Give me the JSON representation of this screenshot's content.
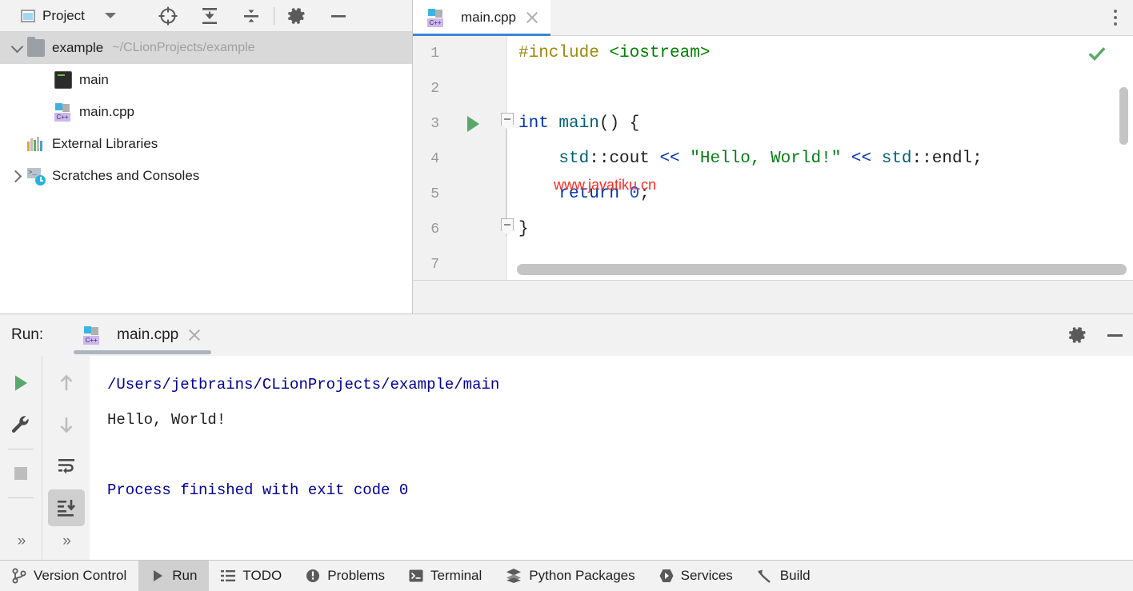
{
  "project_panel": {
    "title": "Project",
    "icons": [
      "project-window-icon",
      "chevron-down-icon",
      "locate-icon",
      "expand-all-icon",
      "collapse-all-icon",
      "gear-icon",
      "minimize-icon"
    ],
    "tree": [
      {
        "label": "example",
        "path": "~/CLionProjects/example",
        "icon": "folder-icon",
        "twisty": "down",
        "selected": true,
        "depth": 0
      },
      {
        "label": "main",
        "path": "",
        "icon": "binary-icon",
        "twisty": "none",
        "selected": false,
        "depth": 1
      },
      {
        "label": "main.cpp",
        "path": "",
        "icon": "cpp-file-icon",
        "twisty": "none",
        "selected": false,
        "depth": 1
      },
      {
        "label": "External Libraries",
        "path": "",
        "icon": "libraries-icon",
        "twisty": "none",
        "selected": false,
        "depth": 0
      },
      {
        "label": "Scratches and Consoles",
        "path": "",
        "icon": "scratches-icon",
        "twisty": "right",
        "selected": false,
        "depth": 0
      }
    ]
  },
  "editor": {
    "tab": {
      "label": "main.cpp",
      "icon": "cpp-file-icon",
      "close": "close-icon",
      "active": true
    },
    "kebab": "more-options-icon",
    "inspection_status": "ok-check-icon",
    "watermark": "www.javatiku.cn",
    "gutter_numbers": [
      "1",
      "2",
      "3",
      "4",
      "5",
      "6",
      "7"
    ],
    "run_gutter_line": 3,
    "fold_lines": [
      3,
      6
    ],
    "lines": [
      {
        "n": 1,
        "tokens": [
          {
            "t": "#include ",
            "c": "tk-pre"
          },
          {
            "t": "<iostream>",
            "c": "tk-inc"
          }
        ]
      },
      {
        "n": 2,
        "tokens": []
      },
      {
        "n": 3,
        "tokens": [
          {
            "t": "int ",
            "c": "tk-kw"
          },
          {
            "t": "main",
            "c": "tk-fn"
          },
          {
            "t": "() {",
            "c": "tk-pl"
          }
        ]
      },
      {
        "n": 4,
        "tokens": [
          {
            "t": "    ",
            "c": "tk-pl"
          },
          {
            "t": "std",
            "c": "tk-ns"
          },
          {
            "t": "::",
            "c": "tk-pl"
          },
          {
            "t": "cout ",
            "c": "tk-pl"
          },
          {
            "t": "<< ",
            "c": "tk-op"
          },
          {
            "t": "\"Hello, World!\"",
            "c": "tk-str"
          },
          {
            "t": " << ",
            "c": "tk-op"
          },
          {
            "t": "std",
            "c": "tk-ns"
          },
          {
            "t": "::",
            "c": "tk-pl"
          },
          {
            "t": "endl",
            "c": "tk-pl"
          },
          {
            "t": ";",
            "c": "tk-pl"
          }
        ]
      },
      {
        "n": 5,
        "tokens": [
          {
            "t": "    ",
            "c": "tk-pl"
          },
          {
            "t": "return ",
            "c": "tk-kw"
          },
          {
            "t": "0",
            "c": "tk-num"
          },
          {
            "t": ";",
            "c": "tk-pl"
          }
        ]
      },
      {
        "n": 6,
        "tokens": [
          {
            "t": "}",
            "c": "tk-pl"
          }
        ]
      },
      {
        "n": 7,
        "tokens": []
      }
    ]
  },
  "run_panel": {
    "label": "Run:",
    "tab": {
      "label": "main.cpp",
      "icon": "cpp-file-icon",
      "close": "close-icon"
    },
    "header_icons": [
      "gear-icon",
      "minimize-icon"
    ],
    "toolbar_left": [
      "rerun-icon",
      "wrench-icon",
      "stop-icon",
      "expand-icon"
    ],
    "toolbar_right": [
      "arrow-up-icon",
      "arrow-down-icon",
      "soft-wrap-icon",
      "scroll-to-end-icon",
      "expand-icon"
    ],
    "console": [
      {
        "text": "/Users/jetbrains/CLionProjects/example/main",
        "color": "c-blue"
      },
      {
        "text": "Hello, World!",
        "color": "c-black"
      },
      {
        "text": "",
        "color": "c-black"
      },
      {
        "text": "Process finished with exit code 0",
        "color": "c-blue"
      }
    ]
  },
  "statusbar": {
    "items": [
      {
        "label": "Version Control",
        "icon": "branch-icon",
        "active": false
      },
      {
        "label": "Run",
        "icon": "run-icon",
        "active": true
      },
      {
        "label": "TODO",
        "icon": "todo-icon",
        "active": false
      },
      {
        "label": "Problems",
        "icon": "problems-icon",
        "active": false
      },
      {
        "label": "Terminal",
        "icon": "terminal-icon",
        "active": false
      },
      {
        "label": "Python Packages",
        "icon": "packages-icon",
        "active": false
      },
      {
        "label": "Services",
        "icon": "services-icon",
        "active": false
      },
      {
        "label": "Build",
        "icon": "build-icon",
        "active": false
      }
    ]
  },
  "colors": {
    "accent_tab": "#3b87d6",
    "run_green": "#59a869",
    "watermark_red": "#ff2b1f",
    "console_blue": "#000099",
    "selection_grey": "#d9d9d9"
  }
}
